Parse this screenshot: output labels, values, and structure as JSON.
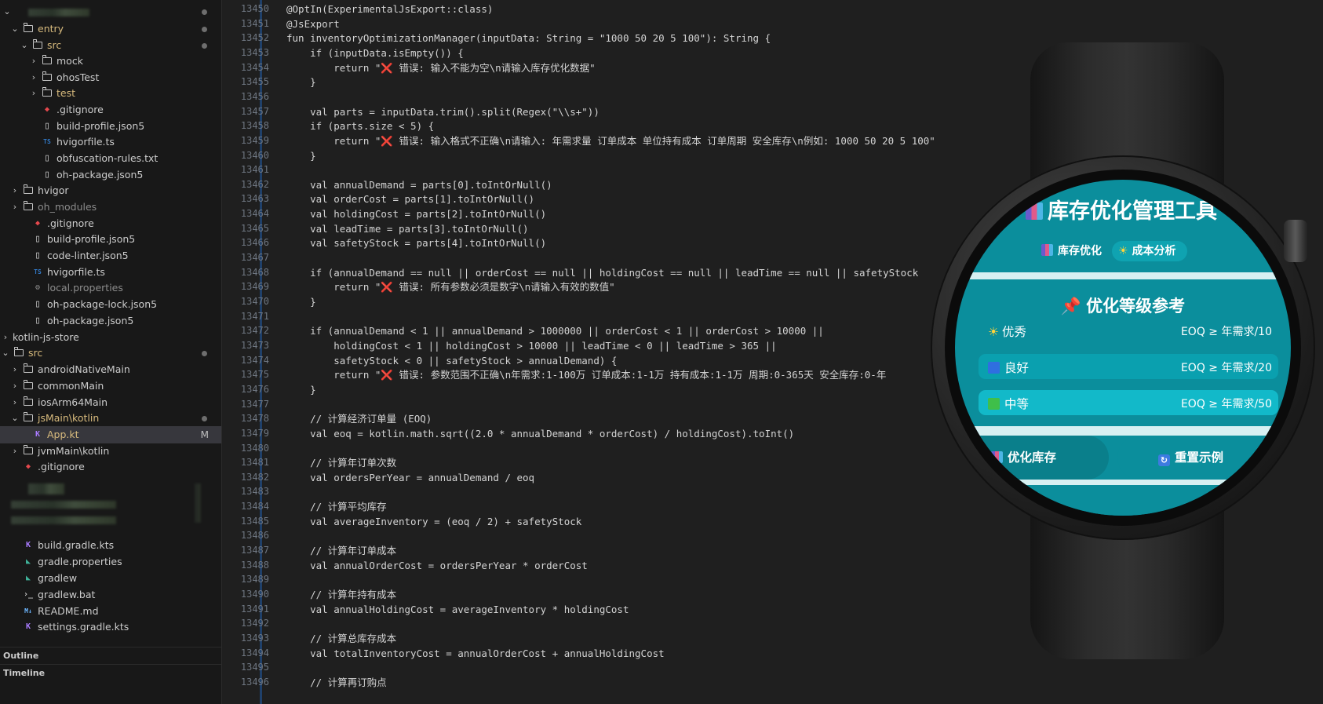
{
  "sidebar": {
    "items": [
      {
        "label": "entry",
        "modified": true
      },
      {
        "label": "src",
        "modified": true
      },
      {
        "label": "mock"
      },
      {
        "label": "ohosTest"
      },
      {
        "label": "test"
      },
      {
        "label": ".gitignore"
      },
      {
        "label": "build-profile.json5"
      },
      {
        "label": "hvigorfile.ts"
      },
      {
        "label": "obfuscation-rules.txt"
      },
      {
        "label": "oh-package.json5"
      },
      {
        "label": "hvigor"
      },
      {
        "label": "oh_modules"
      },
      {
        "label": ".gitignore"
      },
      {
        "label": "build-profile.json5"
      },
      {
        "label": "code-linter.json5"
      },
      {
        "label": "hvigorfile.ts"
      },
      {
        "label": "local.properties"
      },
      {
        "label": "oh-package-lock.json5"
      },
      {
        "label": "oh-package.json5"
      },
      {
        "label": "kotlin-js-store"
      },
      {
        "label": "src",
        "modified": true
      },
      {
        "label": "androidNativeMain"
      },
      {
        "label": "commonMain"
      },
      {
        "label": "iosArm64Main"
      },
      {
        "label": "jsMain\\kotlin",
        "modified": true
      },
      {
        "label": "App.kt",
        "badge": "M"
      },
      {
        "label": "jvmMain\\kotlin"
      },
      {
        "label": ".gitignore"
      },
      {
        "label": "build.gradle.kts"
      },
      {
        "label": "gradle.properties"
      },
      {
        "label": "gradlew"
      },
      {
        "label": "gradlew.bat"
      },
      {
        "label": "README.md"
      },
      {
        "label": "settings.gradle.kts"
      }
    ],
    "ts_badge": "TS",
    "md_badge": "M↓",
    "outline_label": "Outline",
    "timeline_label": "Timeline"
  },
  "editor": {
    "lines": [
      {
        "n": "13450",
        "code": "@OptIn(ExperimentalJsExport::class)"
      },
      {
        "n": "13451",
        "code": "@JsExport"
      },
      {
        "n": "13452",
        "code": "fun inventoryOptimizationManager(inputData: String = \"1000 50 20 5 100\"): String {"
      },
      {
        "n": "13453",
        "code": "    if (inputData.isEmpty()) {"
      },
      {
        "n": "13454",
        "code": "        return \"",
        "x": "❌",
        "post": " 错误: 输入不能为空\\n请输入库存优化数据\""
      },
      {
        "n": "13455",
        "code": "    }"
      },
      {
        "n": "13456",
        "code": ""
      },
      {
        "n": "13457",
        "code": "    val parts = inputData.trim().split(Regex(\"\\\\s+\"))"
      },
      {
        "n": "13458",
        "code": "    if (parts.size < 5) {"
      },
      {
        "n": "13459",
        "code": "        return \"",
        "x": "❌",
        "post": " 错误: 输入格式不正确\\n请输入: 年需求量 订单成本 单位持有成本 订单周期 安全库存\\n例如: 1000 50 20 5 100\""
      },
      {
        "n": "13460",
        "code": "    }"
      },
      {
        "n": "13461",
        "code": ""
      },
      {
        "n": "13462",
        "code": "    val annualDemand = parts[0].toIntOrNull()"
      },
      {
        "n": "13463",
        "code": "    val orderCost = parts[1].toIntOrNull()"
      },
      {
        "n": "13464",
        "code": "    val holdingCost = parts[2].toIntOrNull()"
      },
      {
        "n": "13465",
        "code": "    val leadTime = parts[3].toIntOrNull()"
      },
      {
        "n": "13466",
        "code": "    val safetyStock = parts[4].toIntOrNull()"
      },
      {
        "n": "13467",
        "code": ""
      },
      {
        "n": "13468",
        "code": "    if (annualDemand == null || orderCost == null || holdingCost == null || leadTime == null || safetyStock"
      },
      {
        "n": "13469",
        "code": "        return \"",
        "x": "❌",
        "post": " 错误: 所有参数必须是数字\\n请输入有效的数值\""
      },
      {
        "n": "13470",
        "code": "    }"
      },
      {
        "n": "13471",
        "code": ""
      },
      {
        "n": "13472",
        "code": "    if (annualDemand < 1 || annualDemand > 1000000 || orderCost < 1 || orderCost > 10000 ||"
      },
      {
        "n": "13473",
        "code": "        holdingCost < 1 || holdingCost > 10000 || leadTime < 0 || leadTime > 365 ||"
      },
      {
        "n": "13474",
        "code": "        safetyStock < 0 || safetyStock > annualDemand) {"
      },
      {
        "n": "13475",
        "code": "        return \"",
        "x": "❌",
        "post": " 错误: 参数范围不正确\\n年需求:1-100万 订单成本:1-1万 持有成本:1-1万 周期:0-365天 安全库存:0-年"
      },
      {
        "n": "13476",
        "code": "    }"
      },
      {
        "n": "13477",
        "code": ""
      },
      {
        "n": "13478",
        "code": "    // 计算经济订单量 (EOQ)"
      },
      {
        "n": "13479",
        "code": "    val eoq = kotlin.math.sqrt((2.0 * annualDemand * orderCost) / holdingCost).toInt()"
      },
      {
        "n": "13480",
        "code": ""
      },
      {
        "n": "13481",
        "code": "    // 计算年订单次数"
      },
      {
        "n": "13482",
        "code": "    val ordersPerYear = annualDemand / eoq"
      },
      {
        "n": "13483",
        "code": ""
      },
      {
        "n": "13484",
        "code": "    // 计算平均库存"
      },
      {
        "n": "13485",
        "code": "    val averageInventory = (eoq / 2) + safetyStock"
      },
      {
        "n": "13486",
        "code": ""
      },
      {
        "n": "13487",
        "code": "    // 计算年订单成本"
      },
      {
        "n": "13488",
        "code": "    val annualOrderCost = ordersPerYear * orderCost"
      },
      {
        "n": "13489",
        "code": ""
      },
      {
        "n": "13490",
        "code": "    // 计算年持有成本"
      },
      {
        "n": "13491",
        "code": "    val annualHoldingCost = averageInventory * holdingCost"
      },
      {
        "n": "13492",
        "code": ""
      },
      {
        "n": "13493",
        "code": "    // 计算总库存成本"
      },
      {
        "n": "13494",
        "code": "    val totalInventoryCost = annualOrderCost + annualHoldingCost"
      },
      {
        "n": "13495",
        "code": ""
      },
      {
        "n": "13496",
        "code": "    // 计算再订购点"
      }
    ]
  },
  "watch": {
    "title": "库存优化管理工具",
    "tabs": [
      {
        "label": "库存优化",
        "active": false
      },
      {
        "label": "成本分析",
        "active": true
      }
    ],
    "section_title": "优化等级参考",
    "grades": [
      {
        "name": "优秀",
        "value": "EOQ ≥ 年需求/10"
      },
      {
        "name": "良好",
        "value": "EOQ ≥ 年需求/20"
      },
      {
        "name": "中等",
        "value": "EOQ ≥ 年需求/50"
      }
    ],
    "buttons": [
      {
        "label": "优化库存"
      },
      {
        "label": "重置示例"
      }
    ],
    "colors": {
      "screen_bg": "#0b8e9c",
      "row_good": "#0aa0af",
      "row_medium": "#12b9c9",
      "active_tab": "#0fa3b1",
      "light_band": "#d7f0f2"
    },
    "icons": [
      "bar-chart-icon",
      "sun-icon",
      "pin-icon",
      "blue-square-icon",
      "green-square-icon",
      "refresh-icon"
    ]
  }
}
